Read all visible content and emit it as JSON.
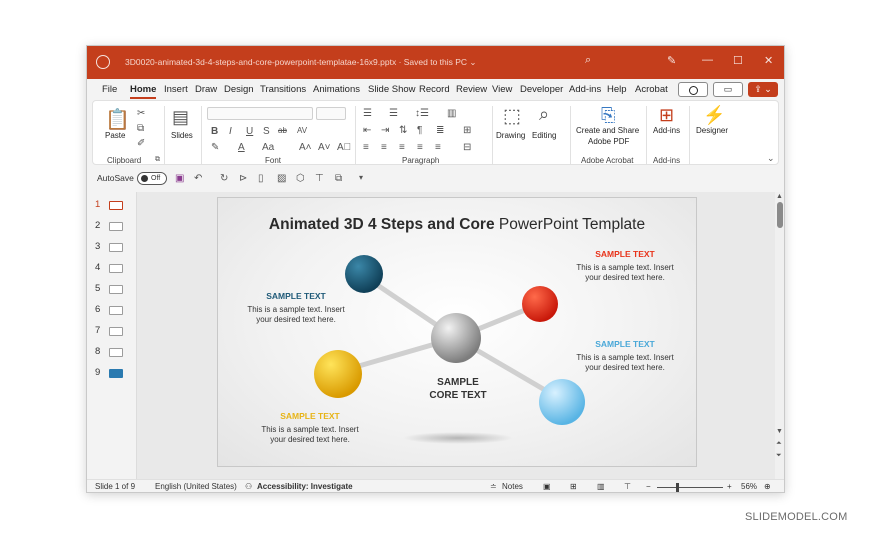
{
  "window": {
    "doc_title": "3D0020-animated-3d-4-steps-and-core-powerpoint-templatae-16x9.pptx  ·  Saved to this PC ⌄",
    "colors": {
      "accent": "#c43e1c"
    }
  },
  "menu": {
    "items": [
      "File",
      "Home",
      "Insert",
      "Draw",
      "Design",
      "Transitions",
      "Animations",
      "Slide Show",
      "Record",
      "Review",
      "View",
      "Developer",
      "Add-ins",
      "Help",
      "Acrobat"
    ],
    "active": "Home"
  },
  "ribbon": {
    "paste": "Paste",
    "slides": "Slides",
    "drawing": "Drawing",
    "editing": "Editing",
    "create_share_line1": "Create and Share",
    "create_share_line2": "Adobe PDF",
    "addins": "Add-ins",
    "designer": "Designer",
    "groups": {
      "clipboard": "Clipboard",
      "font": "Font",
      "paragraph": "Paragraph",
      "adobe_acrobat": "Adobe Acrobat",
      "addins": "Add-ins"
    },
    "font_buttons": [
      "B",
      "I",
      "U",
      "S",
      "ab",
      "AV"
    ]
  },
  "qat": {
    "autosave_label": "AutoSave",
    "toggle_state": "Off"
  },
  "thumbnails": [
    "1",
    "2",
    "3",
    "4",
    "5",
    "6",
    "7",
    "8",
    "9"
  ],
  "slide": {
    "title_bold": "Animated 3D 4 Steps and Core",
    "title_regular": " PowerPoint Template",
    "core_line1": "SAMPLE",
    "core_line2": "CORE TEXT",
    "blocks": [
      {
        "head": "SAMPLE TEXT",
        "color": "#1f5a78",
        "line1": "This is a sample text. Insert",
        "line2": "your desired text here."
      },
      {
        "head": "SAMPLE TEXT",
        "color": "#e8331a",
        "line1": "This is a sample text. Insert",
        "line2": "your desired text here."
      },
      {
        "head": "SAMPLE TEXT",
        "color": "#4aa8d8",
        "line1": "This is a sample text. Insert",
        "line2": "your desired text here."
      },
      {
        "head": "SAMPLE TEXT",
        "color": "#e7b416",
        "line1": "This is a sample text. Insert",
        "line2": "your desired text here."
      }
    ]
  },
  "status": {
    "slide_of": "Slide 1 of 9",
    "language": "English (United States)",
    "accessibility": "Accessibility: Investigate",
    "notes": "Notes",
    "zoom_minus": "−",
    "zoom_plus": "+",
    "zoom": "56%"
  },
  "watermark": "SLIDEMODEL.COM"
}
